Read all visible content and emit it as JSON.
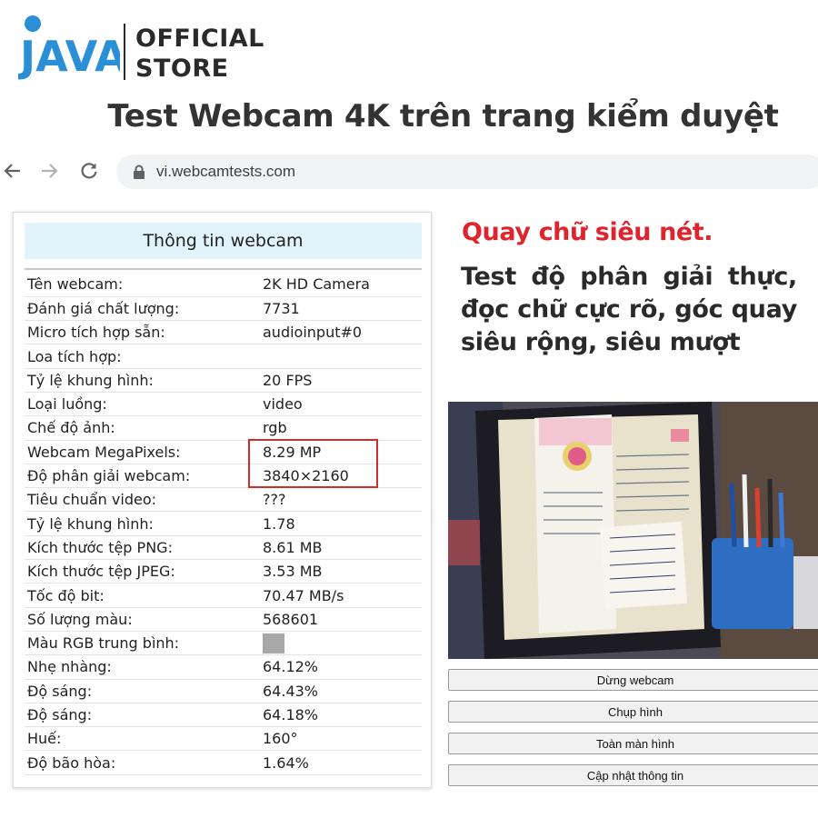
{
  "brand": {
    "logo_text": "JAVA",
    "store_line1": "OFFICIAL",
    "store_line2": "STORE"
  },
  "headline": "Test Webcam 4K trên trang kiểm duyệt",
  "browser": {
    "url": "vi.webcamtests.com"
  },
  "info_panel": {
    "title": "Thông tin webcam",
    "rows": [
      {
        "label": "Tên webcam:",
        "value": "2K HD Camera"
      },
      {
        "label": "Đánh giá chất lượng:",
        "value": "7731"
      },
      {
        "label": "Micro tích hợp sẵn:",
        "value": "audioinput#0"
      },
      {
        "label": "Loa tích hợp:",
        "value": ""
      },
      {
        "label": "Tỷ lệ khung hình:",
        "value": "20 FPS"
      },
      {
        "label": "Loại luồng:",
        "value": "video"
      },
      {
        "label": "Chế độ ảnh:",
        "value": "rgb"
      },
      {
        "label": "Webcam MegaPixels:",
        "value": "8.29 MP"
      },
      {
        "label": "Độ phân giải webcam:",
        "value": "3840×2160"
      },
      {
        "label": "Tiêu chuẩn video:",
        "value": "???"
      },
      {
        "label": "Tỷ lệ khung hình:",
        "value": "1.78"
      },
      {
        "label": "Kích thước tệp PNG:",
        "value": "8.61 MB"
      },
      {
        "label": "Kích thước tệp JPEG:",
        "value": "3.53 MB"
      },
      {
        "label": "Tốc độ bit:",
        "value": "70.47 MB/s"
      },
      {
        "label": "Số lượng màu:",
        "value": "568601"
      },
      {
        "label": "Màu RGB trung bình:",
        "value": ""
      },
      {
        "label": "Nhẹ nhàng:",
        "value": "64.12%"
      },
      {
        "label": "Độ sáng:",
        "value": "64.43%"
      },
      {
        "label": "Độ sáng:",
        "value": "64.18%"
      },
      {
        "label": "Huế:",
        "value": "160°"
      },
      {
        "label": "Độ bão hòa:",
        "value": "1.64%"
      }
    ],
    "average_rgb_color": "#a8a8a8"
  },
  "promo": {
    "title": "Quay chữ siêu nét.",
    "body": "Test độ phân giải thực, đọc chữ cực rõ, góc quay siêu rộng, siêu mượt"
  },
  "buttons": {
    "stop": "Dừng webcam",
    "capture": "Chụp hình",
    "fullscreen": "Toàn màn hình",
    "update": "Cập nhật thông tin"
  },
  "colors": {
    "brand_blue": "#2a8fd6",
    "promo_red": "#e0242e",
    "header_bg": "#e1f3fb",
    "highlight_border": "#d62b2b"
  }
}
